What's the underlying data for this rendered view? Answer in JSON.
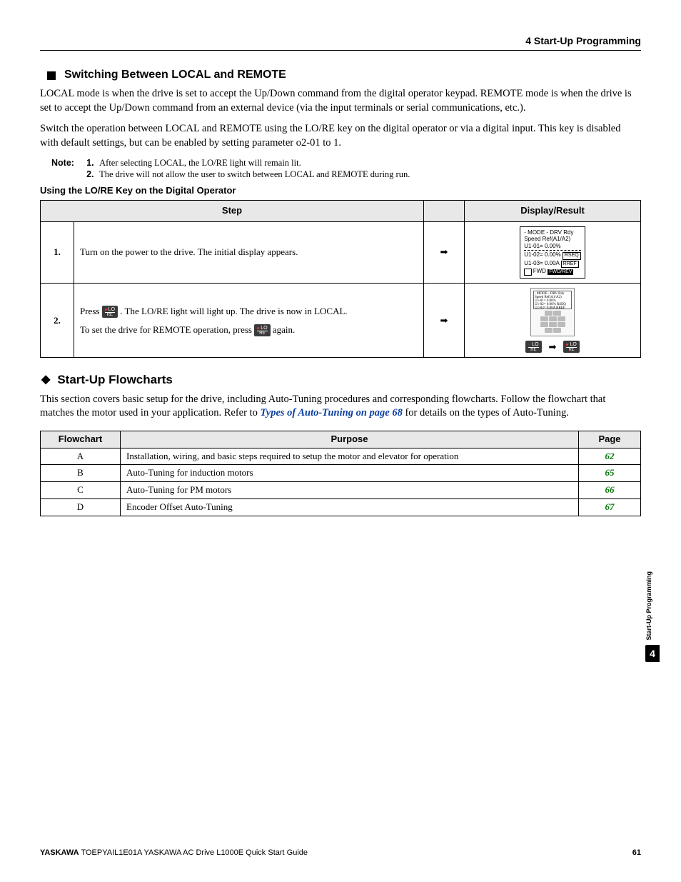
{
  "header": {
    "chapter": "4  Start-Up Programming"
  },
  "sections": {
    "s1": {
      "title": "Switching Between LOCAL and REMOTE",
      "p1": "LOCAL mode is when the drive is set to accept the Up/Down command from the digital operator keypad. REMOTE mode is when the drive is set to accept the Up/Down command from an external device (via the input terminals or serial communications, etc.).",
      "p2": "Switch the operation between LOCAL and REMOTE using the LO/RE key on the digital operator or via a digital input. This key is disabled with default settings, but can be enabled by setting parameter o2-01 to 1.",
      "note_label": "Note:",
      "notes": [
        "After selecting LOCAL, the LO/RE light will remain lit.",
        "The drive will not allow the user to switch between LOCAL and REMOTE during run."
      ],
      "subheading": "Using the LO/RE Key on the Digital Operator",
      "table": {
        "headers": {
          "step": "Step",
          "display": "Display/Result"
        },
        "rows": [
          {
            "num": "1.",
            "text": "Turn on the power to the drive. The initial display appears.",
            "arrow": "➡",
            "lcd": {
              "l1": "- MODE -   DRV  Rdy",
              "l2": "Speed Ref(A1/A2)",
              "l3": "U1-01=  0.00%",
              "l4a": "U1-02=  0.00%",
              "l4b": "RSEQ",
              "l5a": "U1-03=  0.00A",
              "l5b": "RREF",
              "l6a": "FWD",
              "l6b": "FWD/REV"
            }
          },
          {
            "num": "2.",
            "text1": "Press ",
            "text2": ". The LO/RE light will light up. The drive is now in LOCAL.",
            "text3": "To set the drive for REMOTE operation, press ",
            "text4": " again.",
            "key_label_top": "LO",
            "key_label_bot": "RE",
            "arrow": "➡"
          }
        ]
      }
    },
    "s2": {
      "title": "Start-Up Flowcharts",
      "p1a": "This section covers basic setup for the drive, including Auto-Tuning procedures and corresponding flowcharts. Follow the flowchart that matches the motor used in your application. Refer to ",
      "link": "Types of Auto-Tuning on page 68",
      "p1b": " for details on the types of Auto-Tuning.",
      "table": {
        "headers": {
          "fc": "Flowchart",
          "purpose": "Purpose",
          "page": "Page"
        },
        "rows": [
          {
            "fc": "A",
            "purpose": "Installation, wiring, and basic steps required to setup the motor and elevator for operation",
            "page": "62"
          },
          {
            "fc": "B",
            "purpose": "Auto-Tuning for induction motors",
            "page": "65"
          },
          {
            "fc": "C",
            "purpose": "Auto-Tuning for PM motors",
            "page": "66"
          },
          {
            "fc": "D",
            "purpose": "Encoder Offset Auto-Tuning",
            "page": "67"
          }
        ]
      }
    }
  },
  "sidetab": {
    "text": "Start-Up Programming",
    "num": "4"
  },
  "footer": {
    "brand": "YASKAWA",
    "doc": " TOEPYAIL1E01A YASKAWA AC Drive L1000E Quick Start Guide",
    "page": "61"
  }
}
